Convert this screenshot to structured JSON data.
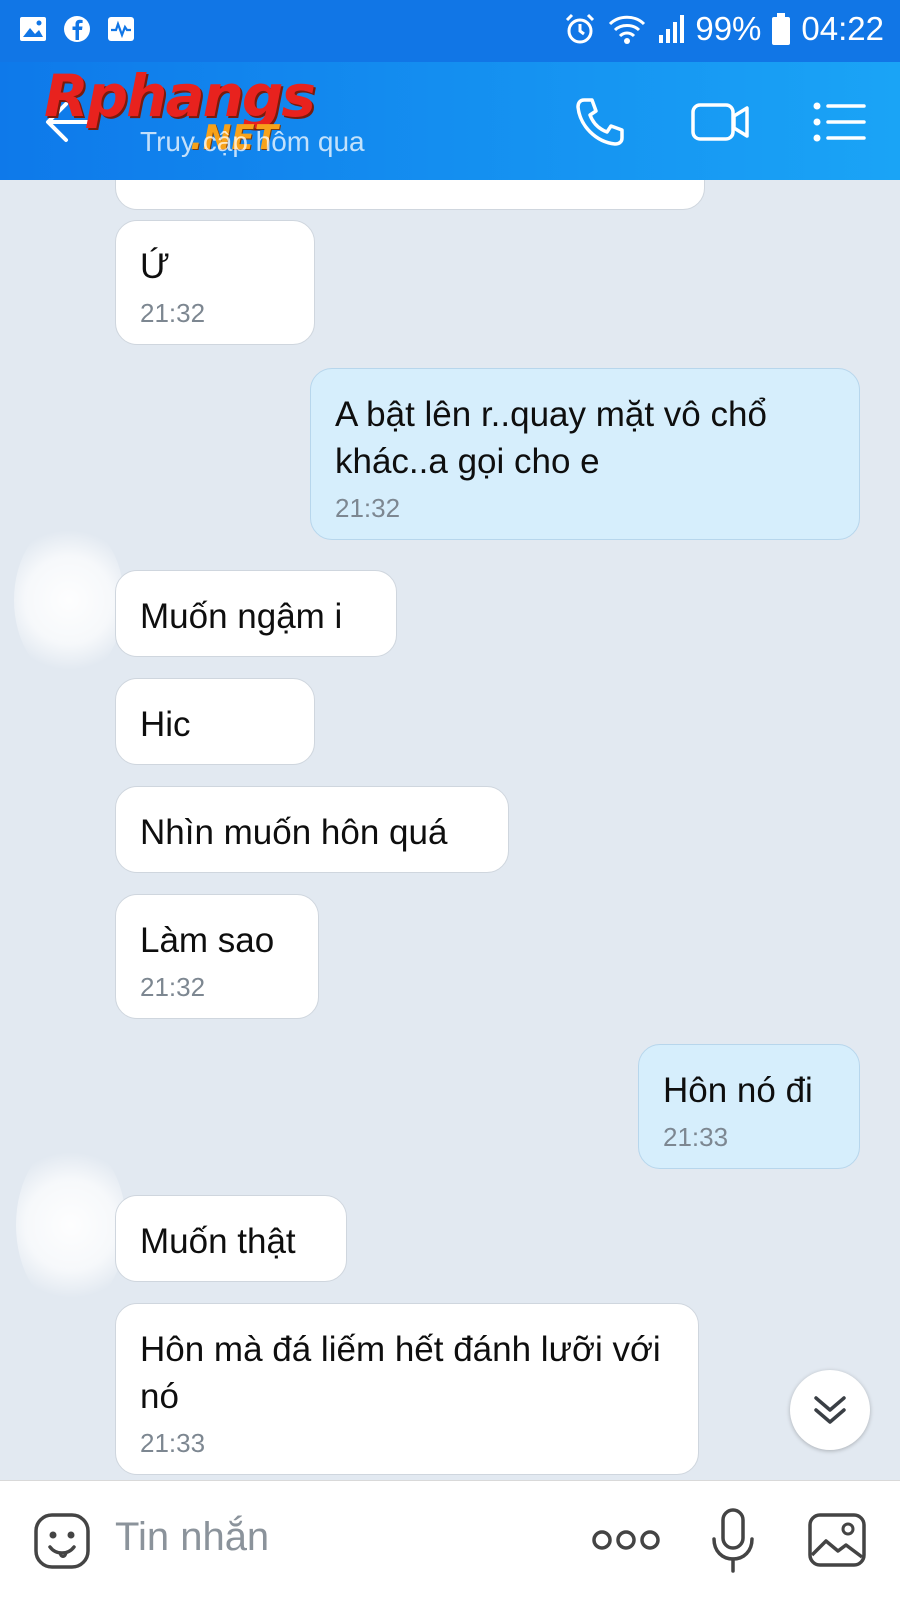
{
  "status_bar": {
    "battery": "99%",
    "time": "04:22",
    "left_icons": [
      "gallery-icon",
      "facebook-icon",
      "activity-icon"
    ],
    "right_icons": [
      "alarm-icon",
      "wifi-icon",
      "signal-icon",
      "battery-icon"
    ]
  },
  "header": {
    "logo_main": "Rphangs",
    "logo_suffix": ".NET",
    "subtitle": "Truy cập hôm qua",
    "icons": [
      "back-arrow-icon",
      "phone-icon",
      "video-call-icon",
      "menu-icon"
    ],
    "background": "#1176e6"
  },
  "messages": [
    {
      "text": "Ứ",
      "time": "21:32",
      "from": "them"
    },
    {
      "text": "A bật lên r..quay mặt vô chổ khác..a gọi cho e",
      "time": "21:32",
      "from": "me"
    },
    {
      "text": "Muốn ngậm i",
      "time": "",
      "from": "them"
    },
    {
      "text": "Hic",
      "time": "",
      "from": "them"
    },
    {
      "text": "Nhìn muốn hôn quá",
      "time": "",
      "from": "them"
    },
    {
      "text": "Làm sao",
      "time": "21:32",
      "from": "them"
    },
    {
      "text": "Hôn nó đi",
      "time": "21:33",
      "from": "me"
    },
    {
      "text": "Muốn thật",
      "time": "",
      "from": "them"
    },
    {
      "text": "Hôn mà đá liếm hết đánh lưỡi với nó",
      "time": "21:33",
      "from": "them"
    }
  ],
  "input_bar": {
    "placeholder": "Tin nhắn",
    "icons": [
      "sticker-icon",
      "more-dots-icon",
      "microphone-icon",
      "image-icon"
    ]
  },
  "scroll_button_icon": "double-chevron-down-icon",
  "colors": {
    "chat_background": "#e2e9f1",
    "my_bubble": "#d6eefc",
    "their_bubble": "#ffffff"
  }
}
